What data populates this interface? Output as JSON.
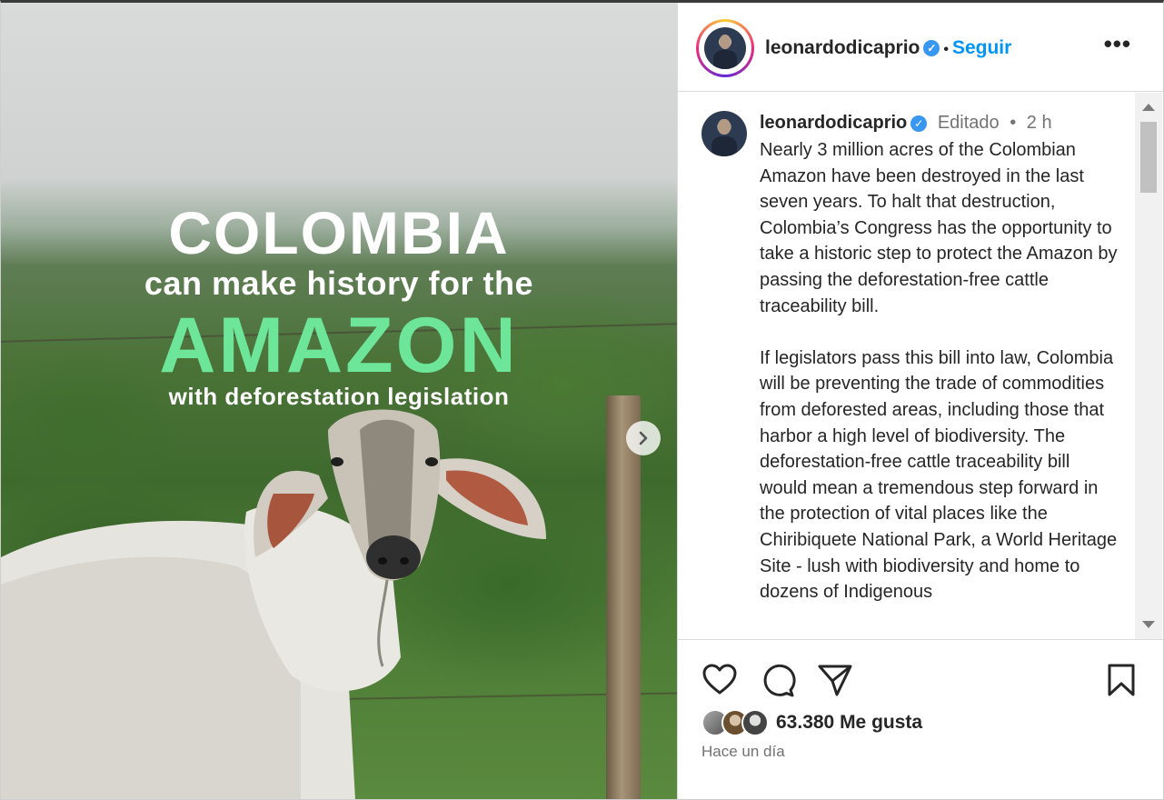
{
  "media": {
    "line1": "COLOMBIA",
    "line2": "can make history for the",
    "line3": "AMAZON",
    "line4": "with deforestation legislation"
  },
  "header": {
    "username": "leonardodicaprio",
    "separator": "•",
    "follow_label": "Seguir",
    "more_label": "•••"
  },
  "caption": {
    "username": "leonardodicaprio",
    "edited": "Editado",
    "separator": "•",
    "age": "2 h",
    "text": "Nearly 3 million acres of the Colombian Amazon have been destroyed in the last seven years. To halt that destruction, Colombia’s Congress has the opportunity to take a historic step to protect the Amazon by passing the deforestation-free cattle traceability bill.\n\nIf legislators pass this bill into law, Colombia will be preventing the trade of commodities from deforested areas, including those that harbor a high level of biodiversity. The deforestation-free cattle traceability bill would mean a tremendous step forward in the protection of vital places like the Chiribiquete National Park, a World Heritage Site - lush with biodiversity and home to dozens of Indigenous"
  },
  "actions": {
    "icons": [
      "heart-icon",
      "comment-icon",
      "share-icon",
      "bookmark-icon"
    ],
    "likes": "63.380 Me gusta",
    "posted": "Hace un día"
  },
  "colors": {
    "follow": "#0095f6",
    "amazon_text": "#6de69a",
    "verified": "#3897f0"
  }
}
